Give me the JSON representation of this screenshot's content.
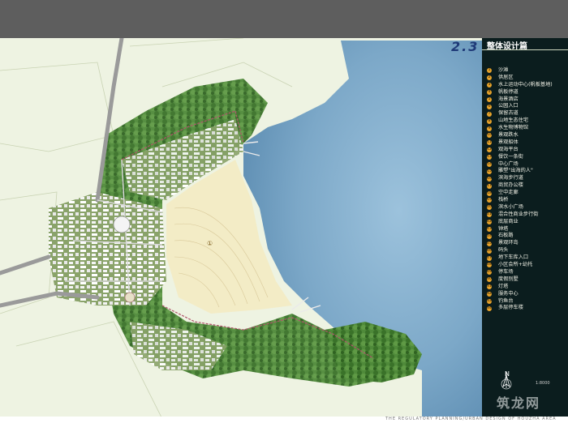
{
  "plan": {
    "section_number": "2.3",
    "section_title": "整体设计篇",
    "legend": [
      "沙滩",
      "供居区",
      "水上运动中心(帆板基地)",
      "帆板停道",
      "海景酒店",
      "公园入口",
      "保留古道",
      "山地生态住宅",
      "水生物博物馆",
      "景观跌水",
      "景观船体",
      "观海平台",
      "餐饮一条街",
      "中心广场",
      "雕塑\"出海的人\"",
      "滨海步行道",
      "商贸办公楼",
      "空中走廊",
      "栈桥",
      "滨水小广场",
      "混合性商业步行街",
      "底层商业",
      "钟塔",
      "石板路",
      "景观环岛",
      "码头",
      "地下车库入口",
      "小区会所+幼托",
      "停车场",
      "度假别墅",
      "灯塔",
      "服务中心",
      "钓鱼台",
      "多层停车楼"
    ],
    "map_marker": "①",
    "compass_letter": "N",
    "watermark": "筑龙网",
    "scale_note": "1:8000",
    "footer": "THE REGULATORY PLANNING/URBAN DESIGN OF HOUZHA AREA"
  },
  "colors": {
    "sea": "#7fa9c9",
    "beach": "#f3ecc6",
    "legend_bg": "#0b1d1e",
    "legend_marker": "#e7a32a",
    "forest": "#3f7a31",
    "road": "#8c8c8c"
  }
}
